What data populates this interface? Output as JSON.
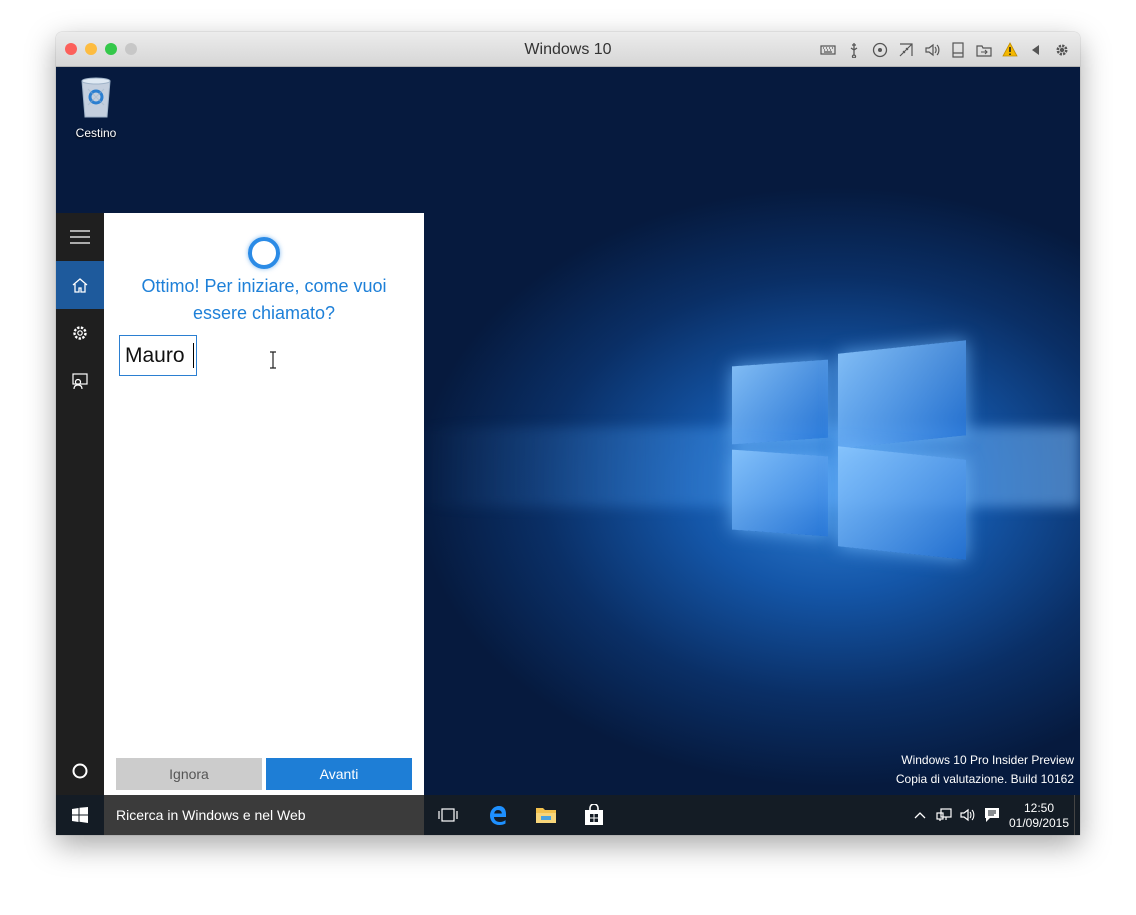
{
  "window": {
    "title": "Windows 10",
    "traffic_lights": [
      "#fc605b",
      "#fdbc40",
      "#34c84a",
      "#c7c7c7"
    ],
    "toolbar_icons": [
      "keyboard-icon",
      "usb-icon",
      "disc-icon",
      "network-icon",
      "sound-icon",
      "device-icon",
      "folder-share-icon",
      "warning-icon",
      "arrow-left-icon",
      "gear-icon"
    ]
  },
  "desktop": {
    "recycle_bin_label": "Cestino",
    "watermark_line1": "Windows 10 Pro Insider Preview",
    "watermark_line2": "Copia di valutazione. Build 10162"
  },
  "cortana": {
    "prompt": "Ottimo! Per iniziare, come vuoi essere chiamato?",
    "name_value": "Mauro",
    "ignore_label": "Ignora",
    "next_label": "Avanti",
    "accent": "#1e7ed6"
  },
  "taskbar": {
    "search_text": "Ricerca in Windows e nel Web",
    "time": "12:50",
    "date": "01/09/2015"
  }
}
